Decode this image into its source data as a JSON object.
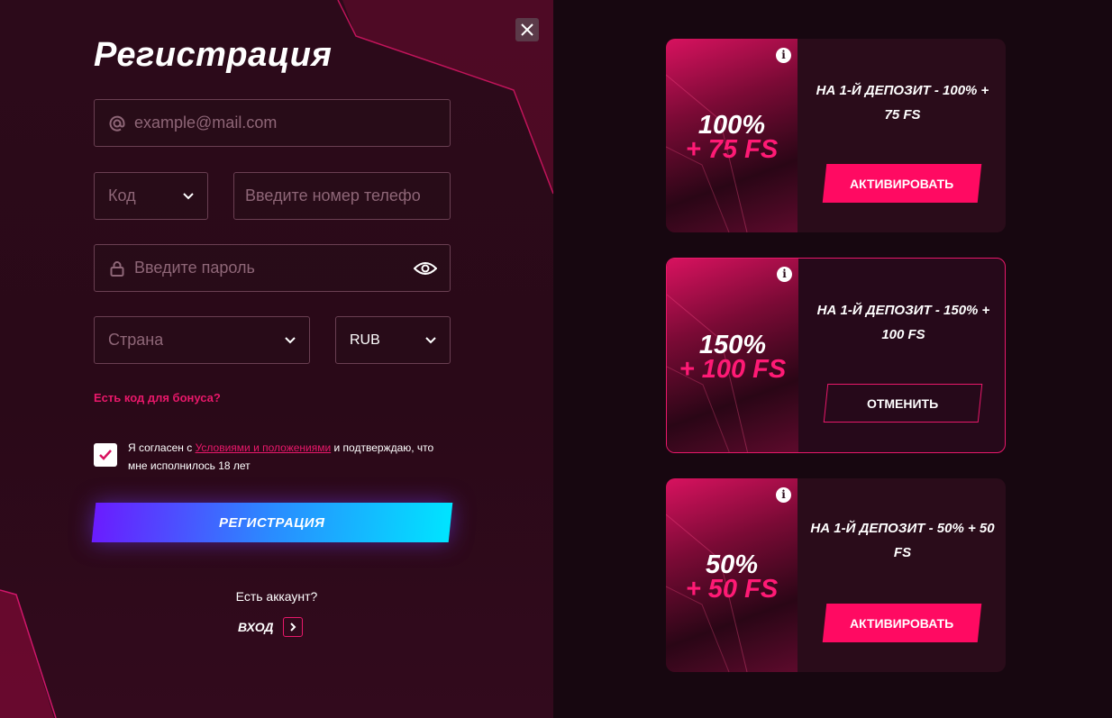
{
  "form": {
    "title": "Регистрация",
    "email_placeholder": "example@mail.com",
    "code_placeholder": "Код",
    "phone_placeholder": "Введите номер телефо",
    "password_placeholder": "Введите пароль",
    "country_placeholder": "Страна",
    "currency_value": "RUB",
    "bonus_code_link": "Есть код для бонуса?",
    "terms_prefix": "Я согласен с ",
    "terms_link": "Условиями и положениями",
    "terms_suffix": " и подтверждаю, что мне исполнилось 18 лет",
    "terms_checked": true,
    "register_button": "РЕГИСТРАЦИЯ",
    "have_account": "Есть аккаунт?",
    "login_label": "ВХОД"
  },
  "bonuses": [
    {
      "percent": "100%",
      "spins": "+ 75 FS",
      "description": "НА 1-Й ДЕПОЗИТ - 100% + 75 FS",
      "button": "АКТИВИРОВАТЬ",
      "state": "available"
    },
    {
      "percent": "150%",
      "spins": "+ 100 FS",
      "description": "НА 1-Й ДЕПОЗИТ - 150% + 100 FS",
      "button": "ОТМЕНИТЬ",
      "state": "selected"
    },
    {
      "percent": "50%",
      "spins": "+ 50 FS",
      "description": "НА 1-Й ДЕПОЗИТ - 50% + 50 FS",
      "button": "АКТИВИРОВАТЬ",
      "state": "available"
    }
  ],
  "icons": {
    "close": "close-icon",
    "email": "at-icon",
    "password": "lock-icon",
    "show_password": "eye-icon",
    "dropdown": "chevron-down-icon",
    "info": "info-icon",
    "login_arrow": "chevron-right-icon"
  },
  "colors": {
    "accent": "#ff0a62",
    "link": "#e8186a",
    "register_gradient_start": "#6a1cff",
    "register_gradient_end": "#00e4ff"
  }
}
